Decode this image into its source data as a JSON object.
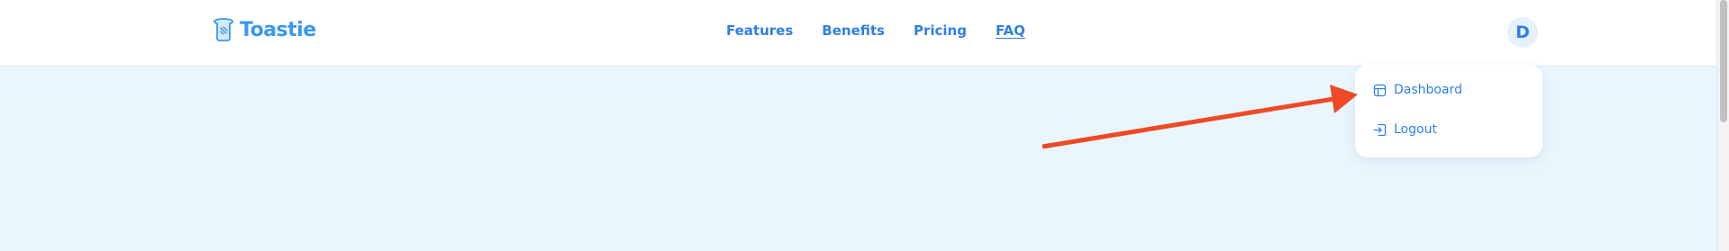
{
  "header": {
    "logo_text": "Toastie",
    "nav": [
      {
        "label": "Features"
      },
      {
        "label": "Benefits"
      },
      {
        "label": "Pricing"
      },
      {
        "label": "FAQ"
      }
    ],
    "avatar_initial": "D"
  },
  "user_menu": {
    "items": [
      {
        "label": "Dashboard",
        "icon": "layout-icon"
      },
      {
        "label": "Logout",
        "icon": "logout-icon"
      }
    ]
  },
  "colors": {
    "accent": "#2f7fe6",
    "logo": "#3c97ee",
    "background": "#eaf6fd",
    "annotation": "#ef4a26"
  }
}
